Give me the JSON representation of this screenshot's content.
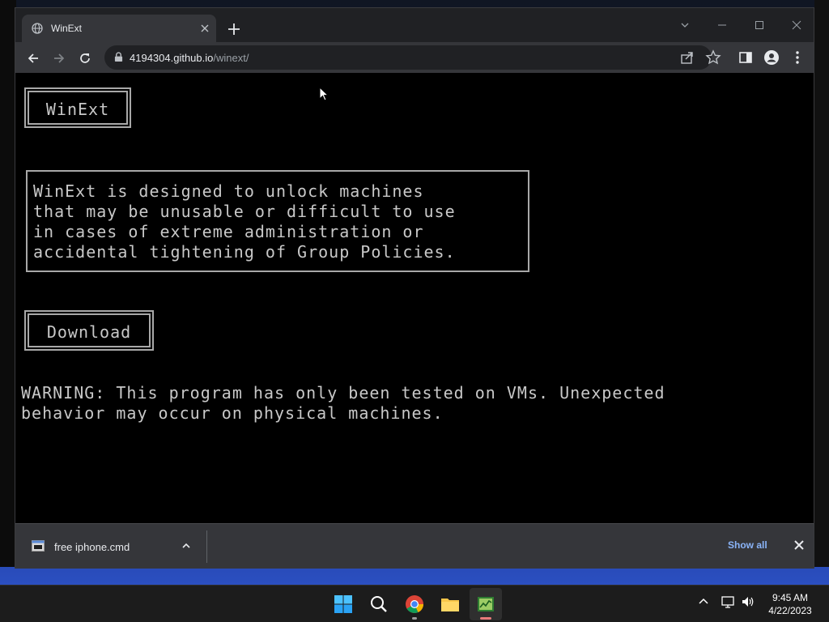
{
  "browser": {
    "tab_title": "WinExt",
    "url_host": "4194304.github.io",
    "url_path": "/winext/"
  },
  "page": {
    "title_button": "WinExt",
    "description": "WinExt is designed to unlock machines\nthat may be unusable or difficult to use\nin cases of extreme administration or\naccidental tightening of Group Policies.",
    "download_button": "Download",
    "warning": "WARNING: This program has only been tested on VMs. Unexpected\nbehavior may occur on physical machines."
  },
  "downloads": {
    "file_name": "free iphone.cmd",
    "show_all": "Show all"
  },
  "taskbar": {
    "time": "9:45 AM",
    "date": "4/22/2023"
  },
  "colors": {
    "page_bg": "#000000",
    "terminal_text": "#c8c8c8",
    "link_blue": "#8ab4f8"
  }
}
